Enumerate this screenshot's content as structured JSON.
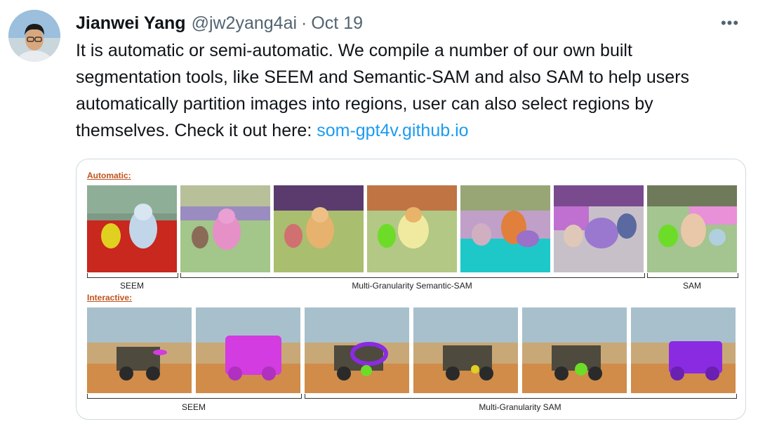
{
  "author": {
    "name": "Jianwei Yang",
    "handle": "@jw2yang4ai",
    "separator": "·",
    "date": "Oct 19"
  },
  "more_label": "•••",
  "tweet": {
    "text": "It is automatic or semi-automatic. We compile a number of our own built segmentation tools, like SEEM and Semantic-SAM and also SAM to help users automatically partition images into regions, user can also select regions by themselves. Check it out here: ",
    "link": "som-gpt4v.github.io"
  },
  "figure": {
    "automatic_label": "Automatic:",
    "interactive_label": "Interactive:",
    "row1_captions": [
      "SEEM",
      "Multi-Granularity Semantic-SAM",
      "SAM"
    ],
    "row2_captions": [
      "SEEM",
      "Multi-Granularity SAM"
    ],
    "colors": {
      "section_label": "#c0541e",
      "link": "#1d9bf0",
      "seem_red": "#c8281e",
      "mask_yellow": "#e0d020",
      "mask_magenta": "#d23ce0",
      "mask_purple": "#8a2be2",
      "mask_green": "#6ddc28",
      "mask_cyan": "#1ec8c8"
    }
  }
}
